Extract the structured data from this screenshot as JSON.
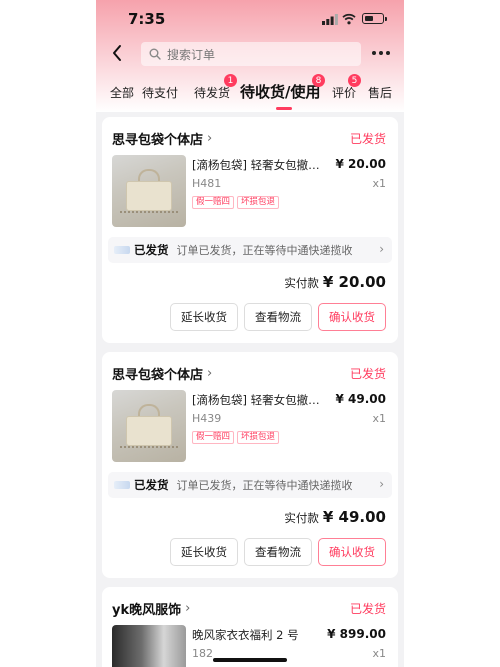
{
  "status_bar": {
    "time": "7:35"
  },
  "header": {
    "search_placeholder": "搜索订单",
    "tabs": [
      {
        "label": "全部"
      },
      {
        "label": "待支付"
      },
      {
        "label": "待发货",
        "badge": "1"
      },
      {
        "label": "待收货/使用",
        "badge": "8",
        "active": true
      },
      {
        "label": "评价",
        "badge": "5"
      },
      {
        "label": "售后"
      }
    ]
  },
  "orders": [
    {
      "shop": "思寻包袋个体店",
      "status": "已发货",
      "product_name": "[滴杨包袋] 轻奢女包撤…",
      "price": "¥ 20.00",
      "sku": "H481",
      "qty": "x1",
      "tags": [
        "假一赔四",
        "坏损包退"
      ],
      "logistics_status": "已发货",
      "logistics_text": "订单已发货，正在等待中通快递揽收",
      "paid_label": "实付款",
      "paid_amount": "¥ 20.00",
      "buttons": {
        "extend": "延长收货",
        "track": "查看物流",
        "confirm": "确认收货"
      }
    },
    {
      "shop": "思寻包袋个体店",
      "status": "已发货",
      "product_name": "[滴杨包袋] 轻奢女包撤…",
      "price": "¥ 49.00",
      "sku": "H439",
      "qty": "x1",
      "tags": [
        "假一赔四",
        "坏损包退"
      ],
      "logistics_status": "已发货",
      "logistics_text": "订单已发货，正在等待中通快递揽收",
      "paid_label": "实付款",
      "paid_amount": "¥ 49.00",
      "buttons": {
        "extend": "延长收货",
        "track": "查看物流",
        "confirm": "确认收货"
      }
    },
    {
      "shop": "yk晚风服饰",
      "status": "已发货",
      "product_name": "晚风家衣衣福利 2 号",
      "price": "¥ 899.00",
      "sku": "182",
      "qty": "x1"
    }
  ]
}
